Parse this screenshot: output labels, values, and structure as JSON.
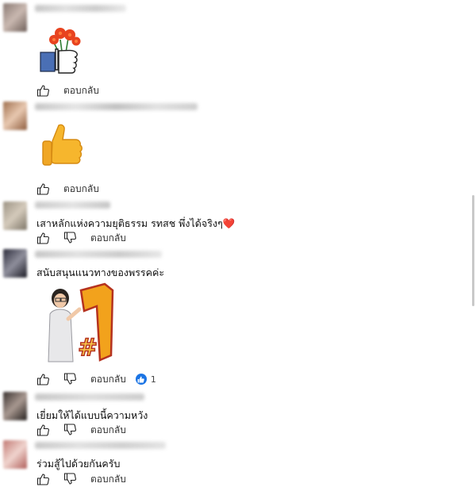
{
  "reply_label": "ตอบกลับ",
  "comments": [
    {
      "text": ""
    },
    {
      "text": ""
    },
    {
      "text": "เสาหลักแห่งความยุติธรรม รทสช พึ่งได้จริงๆ❤️"
    },
    {
      "text": "สนับสนุนแนวทางของพรรคค่ะ",
      "likes": "1"
    },
    {
      "text": "เยี่ยมให้ได้แบบนี้ความหวัง"
    },
    {
      "text": "ร่วมสู้ไปด้วยกันครับ"
    }
  ],
  "icons": [
    "thumb-up-outline-icon",
    "thumb-down-outline-icon",
    "like-reaction-icon"
  ],
  "colors": {
    "link": "#1b74e4",
    "heart": "#e0243a",
    "flower": "#e8431f"
  }
}
